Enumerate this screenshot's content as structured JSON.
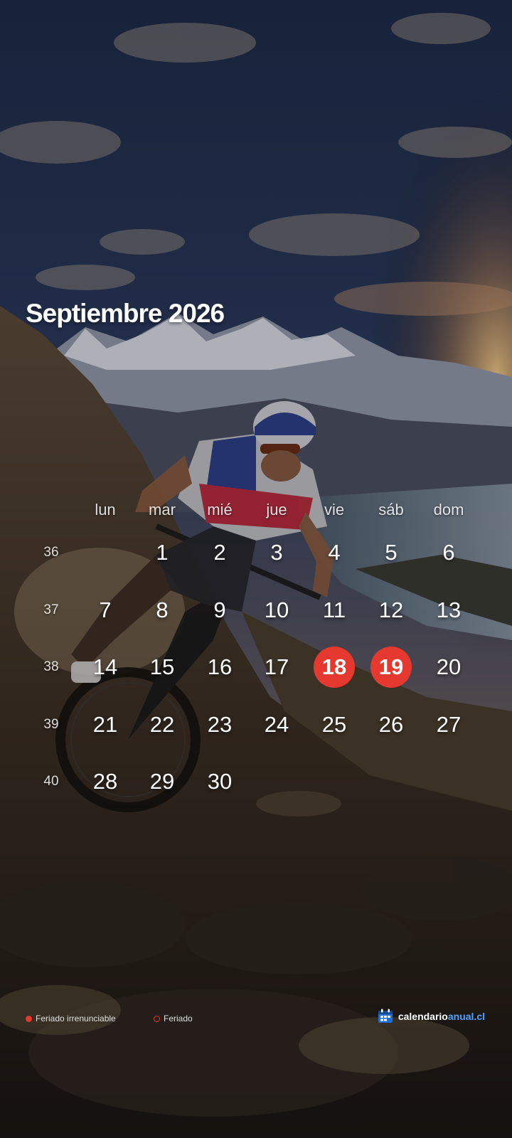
{
  "title": "Septiembre 2026",
  "weekdays": [
    "lun",
    "mar",
    "mié",
    "jue",
    "vie",
    "sáb",
    "dom"
  ],
  "weeks": [
    {
      "number": "36",
      "days": [
        "",
        "1",
        "2",
        "3",
        "4",
        "5",
        "6"
      ]
    },
    {
      "number": "37",
      "days": [
        "7",
        "8",
        "9",
        "10",
        "11",
        "12",
        "13"
      ]
    },
    {
      "number": "38",
      "days": [
        "14",
        "15",
        "16",
        "17",
        "18",
        "19",
        "20"
      ]
    },
    {
      "number": "39",
      "days": [
        "21",
        "22",
        "23",
        "24",
        "25",
        "26",
        "27"
      ]
    },
    {
      "number": "40",
      "days": [
        "28",
        "29",
        "30",
        "",
        "",
        "",
        ""
      ]
    }
  ],
  "holidays_irrenunciable": [
    "18",
    "19"
  ],
  "legend": {
    "irrenunciable": "Feriado irrenunciable",
    "feriado": "Feriado"
  },
  "brand": {
    "part1": "calendario",
    "part2": "anual.cl",
    "icon": "calendar-icon"
  },
  "colors": {
    "holiday": "#e5392f",
    "brand_accent": "#4aa3ff"
  }
}
